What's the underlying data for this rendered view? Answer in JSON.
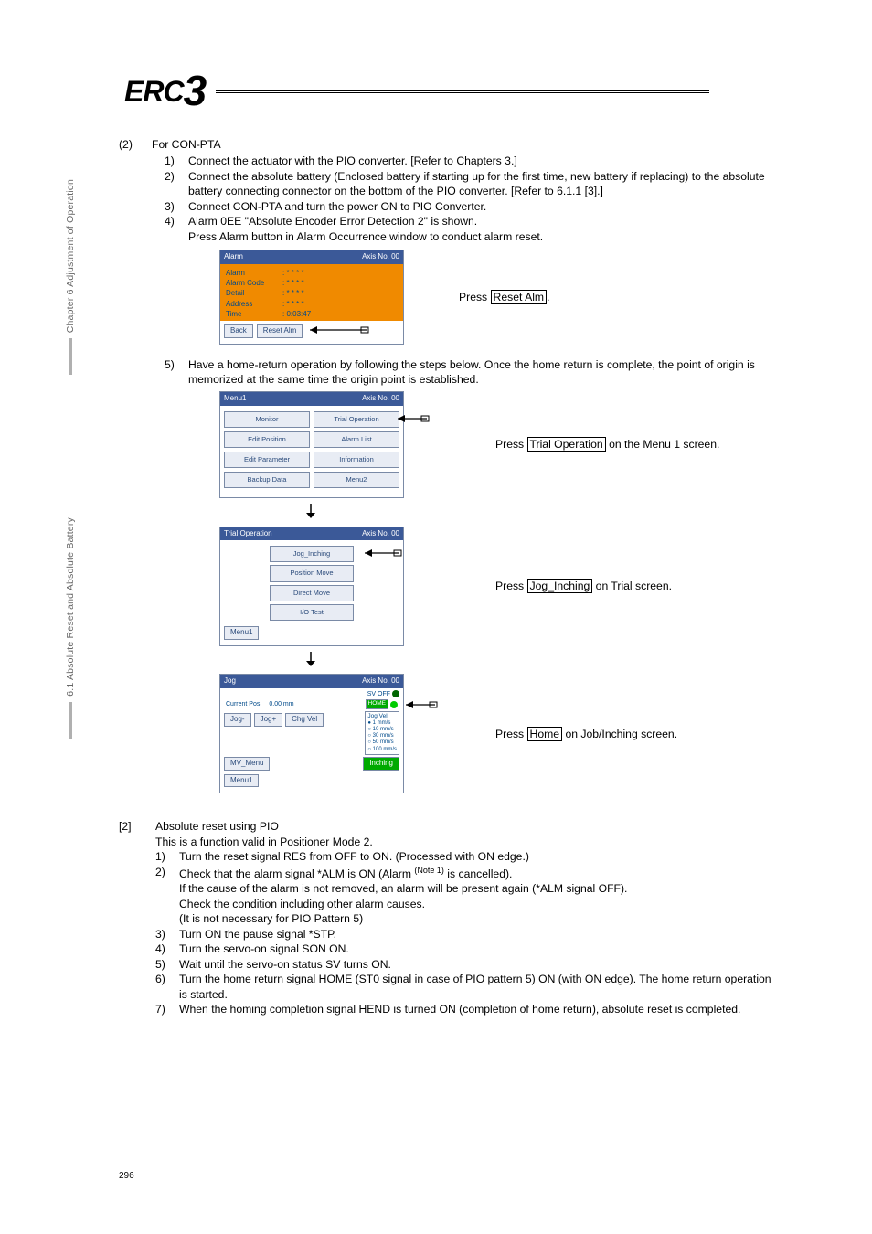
{
  "sidebar": {
    "chapter_label": "Chapter 6 Adjustment of Operation",
    "section_label": "6.1 Absolute Reset and Absolute Battery"
  },
  "logo_text": "ERC",
  "logo_num": "3",
  "section2": {
    "num": "(2)",
    "title": "For CON-PTA",
    "items": [
      {
        "n": "1)",
        "t": "Connect the actuator with the PIO converter. [Refer to Chapters 3.]"
      },
      {
        "n": "2)",
        "t": "Connect the absolute battery (Enclosed battery if starting up for the first time, new battery if replacing) to the absolute battery connecting connector on the bottom of the PIO converter. [Refer to 6.1.1 [3].]"
      },
      {
        "n": "3)",
        "t": "Connect CON-PTA and turn the power ON to PIO Converter."
      },
      {
        "n": "4)",
        "t": "Alarm 0EE \"Absolute Encoder Error Detection 2\" is shown."
      },
      {
        "cont": "Press Alarm button in Alarm Occurrence window to conduct alarm reset."
      }
    ]
  },
  "shot_alarm": {
    "title_left": "Alarm",
    "title_right": "Axis No. 00",
    "rows": [
      {
        "lab": "Alarm",
        "val": ": * * * *"
      },
      {
        "lab": "Alarm Code",
        "val": ": * * * *"
      },
      {
        "lab": "Detail",
        "val": ": * * * *"
      },
      {
        "lab": "Address",
        "val": ": * * * *"
      },
      {
        "lab": "Time",
        "val": ":    0:03:47"
      }
    ],
    "back": "Back",
    "reset": "Reset Alm"
  },
  "press_reset_prefix": "Press ",
  "press_reset_box": "Reset Alm",
  "press_reset_suffix": ".",
  "step5": {
    "n": "5)",
    "t": "Have a home-return operation by following the steps below. Once the home return is complete, the point of origin is memorized at the same time the origin point is established."
  },
  "shot_menu": {
    "title_left": "Menu1",
    "title_right": "Axis No. 00",
    "btns": [
      "Monitor",
      "Trial Operation",
      "Edit Position",
      "Alarm List",
      "Edit Parameter",
      "Information",
      "Backup Data",
      "Menu2"
    ]
  },
  "caption_menu_prefix": "Press ",
  "caption_menu_box": "Trial Operation",
  "caption_menu_suffix": " on the Menu 1 screen.",
  "shot_trial": {
    "title_left": "Trial Operation",
    "title_right": "Axis No. 00",
    "btns": [
      "Jog_Inching",
      "Position Move",
      "Direct Move",
      "I/O Test"
    ],
    "menu1": "Menu1"
  },
  "caption_trial_prefix": "Press ",
  "caption_trial_box": "Jog_Inching",
  "caption_trial_suffix": " on Trial screen.",
  "shot_jog": {
    "title_left": "Jog",
    "title_right": "Axis No. 00",
    "sv": "SV OFF",
    "home": "HOME",
    "cur_lab": "Current Pos",
    "cur_val": "0.00 mm",
    "jog_vel": "Jog Vel",
    "speeds": [
      "● 1   mm/s",
      "○ 10  mm/s",
      "○ 30  mm/s",
      "○ 50  mm/s",
      "○ 100 mm/s"
    ],
    "jogm": "Jog-",
    "jogp": "Jog+",
    "chg": "Chg Vel",
    "mv": "MV_Menu",
    "inch": "Inching",
    "menu1": "Menu1"
  },
  "caption_jog_prefix": "Press ",
  "caption_jog_box": "Home",
  "caption_jog_suffix": " on Job/Inching screen.",
  "sectionPIO": {
    "num": "[2]",
    "title": "Absolute reset using PIO",
    "intro": "This is a function valid in Positioner Mode 2.",
    "items": [
      {
        "n": "1)",
        "t": "Turn the reset signal RES from OFF to ON. (Processed with ON edge.)"
      },
      {
        "n": "2)",
        "t_pre": "Check that the alarm signal *ALM is ON (Alarm ",
        "note": "(Note 1)",
        "t_post": " is cancelled)."
      },
      {
        "cont": "If the cause of the alarm is not removed, an alarm will be present again (*ALM signal OFF)."
      },
      {
        "cont": "Check the condition including other alarm causes."
      },
      {
        "cont": "(It is not necessary for PIO Pattern 5)"
      },
      {
        "n": "3)",
        "t": "Turn ON the pause signal *STP."
      },
      {
        "n": "4)",
        "t": "Turn the servo-on signal SON ON."
      },
      {
        "n": "5)",
        "t": "Wait until the servo-on status SV turns ON."
      },
      {
        "n": "6)",
        "t": "Turn the home return signal HOME (ST0 signal in case of PIO pattern 5) ON (with ON edge). The home return operation is started."
      },
      {
        "n": "7)",
        "t": "When the homing completion signal HEND is turned ON (completion of home return), absolute reset is completed."
      }
    ]
  },
  "page_number": "296"
}
